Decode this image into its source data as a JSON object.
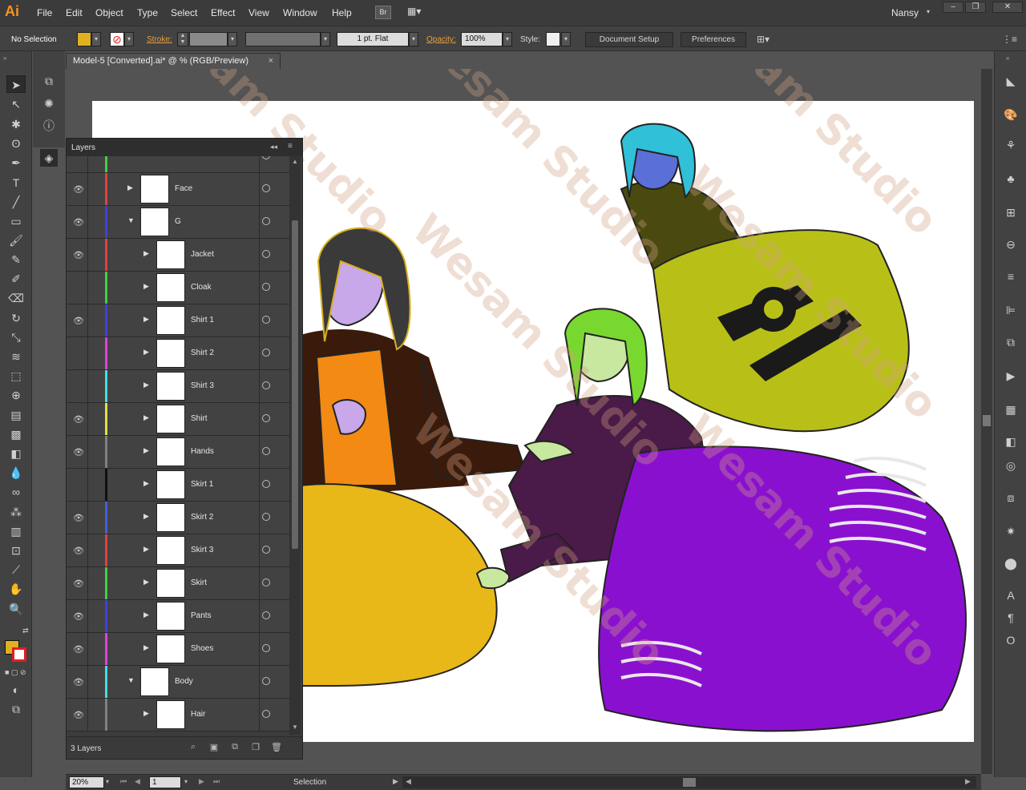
{
  "app": {
    "logo": "Ai",
    "menu": [
      "File",
      "Edit",
      "Object",
      "Type",
      "Select",
      "Effect",
      "View",
      "Window",
      "Help"
    ],
    "bridge_label": "Br",
    "user": "Nansy"
  },
  "control_bar": {
    "selection_status": "No Selection",
    "stroke_label": "Stroke:",
    "stroke_profile": "1 pt. Flat",
    "opacity_label": "Opacity:",
    "opacity_value": "100%",
    "style_label": "Style:",
    "document_setup": "Document Setup",
    "preferences": "Preferences"
  },
  "document": {
    "tab_title": "Model-5 [Converted].ai* @ % (RGB/Preview)",
    "close_glyph": "×"
  },
  "layers_panel": {
    "title": "Layers",
    "footer_count": "3 Layers",
    "rows": [
      {
        "name": "Face",
        "visible": true,
        "expanded": false,
        "color": "#e04040"
      },
      {
        "name": "G",
        "visible": true,
        "expanded": true,
        "color": "#4040e0"
      },
      {
        "name": "Jacket",
        "visible": true,
        "expanded": false,
        "color": "#e04040"
      },
      {
        "name": "Cloak",
        "visible": false,
        "expanded": false,
        "color": "#40d040"
      },
      {
        "name": "Shirt 1",
        "visible": true,
        "expanded": false,
        "color": "#4040e0"
      },
      {
        "name": "Shirt 2",
        "visible": false,
        "expanded": false,
        "color": "#e040e0"
      },
      {
        "name": "Shirt 3",
        "visible": false,
        "expanded": false,
        "color": "#40e0e0"
      },
      {
        "name": "Shirt",
        "visible": true,
        "expanded": false,
        "color": "#e0e040"
      },
      {
        "name": "Hands",
        "visible": true,
        "expanded": false,
        "color": "#808080"
      },
      {
        "name": "Skirt 1",
        "visible": false,
        "expanded": false,
        "color": "#101010"
      },
      {
        "name": "Skirt 2",
        "visible": true,
        "expanded": false,
        "color": "#4060e0"
      },
      {
        "name": "Skirt 3",
        "visible": true,
        "expanded": false,
        "color": "#e04040"
      },
      {
        "name": "Skirt",
        "visible": true,
        "expanded": false,
        "color": "#40d040"
      },
      {
        "name": "Pants",
        "visible": true,
        "expanded": false,
        "color": "#4040e0"
      },
      {
        "name": "Shoes",
        "visible": true,
        "expanded": false,
        "color": "#e040e0"
      },
      {
        "name": "Body",
        "visible": true,
        "expanded": true,
        "color": "#40e0e0"
      },
      {
        "name": "Hair",
        "visible": true,
        "expanded": false,
        "color": "#808080"
      }
    ]
  },
  "status_bar": {
    "zoom": "20%",
    "page": "1",
    "tool": "Selection"
  },
  "canvas": {
    "watermark_text": "Wesam Studio"
  },
  "colors": {
    "fill": "#e0b020",
    "accent": "#f7941d"
  }
}
